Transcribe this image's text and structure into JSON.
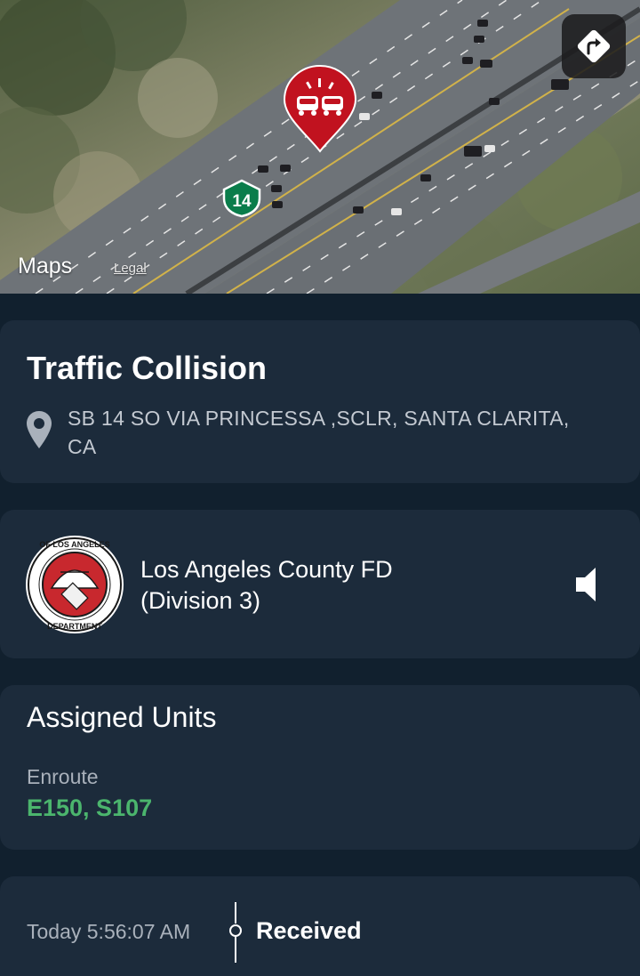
{
  "map": {
    "brand": "Maps",
    "legal": "Legal",
    "route_number": "14",
    "directions_icon": "turn-right-arrow-icon",
    "incident_pin_icon": "car-collision-icon"
  },
  "incident": {
    "title": "Traffic Collision",
    "location": "SB 14 SO VIA PRINCESSA ,SCLR, SANTA CLARITA, CA"
  },
  "agency": {
    "name_line1": "Los Angeles County FD",
    "name_line2": "(Division 3)",
    "seal_top_text": "COUNTY OF LOS ANGELES",
    "seal_bottom_text": "FIRE DEPARTMENT"
  },
  "units": {
    "title": "Assigned Units",
    "status": "Enroute",
    "list": "E150, S107"
  },
  "timeline": {
    "time": "Today 5:56:07 AM",
    "label": "Received"
  },
  "colors": {
    "background": "#11202e",
    "card": "#1c2b3b",
    "accent_green": "#4bb56d",
    "pin_red": "#c1121f"
  }
}
